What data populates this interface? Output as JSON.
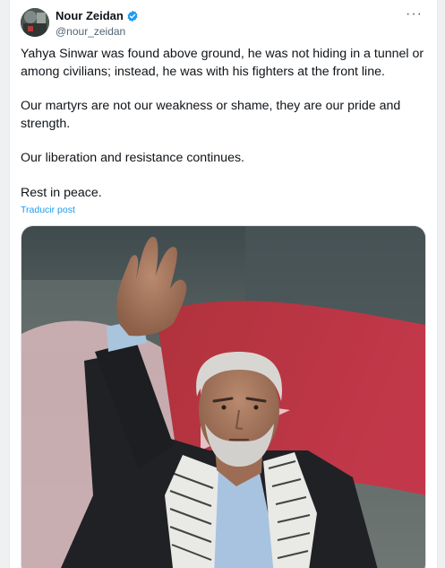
{
  "post": {
    "author": {
      "display_name": "Nour Zeidan",
      "handle": "@nour_zeidan",
      "verified": true
    },
    "more_label": "···",
    "paragraphs": [
      "Yahya Sinwar was found above ground, he was not hiding in a tunnel or among civilians; instead, he was with his fighters at the front line.",
      "Our martyrs are not our weakness or shame, they are our pride and strength.",
      "Our liberation and resistance continues.",
      "Rest in peace."
    ],
    "translate_label": "Traducir post"
  },
  "colors": {
    "link": "#1d9bf0",
    "text": "#0f1419",
    "muted": "#536471"
  }
}
